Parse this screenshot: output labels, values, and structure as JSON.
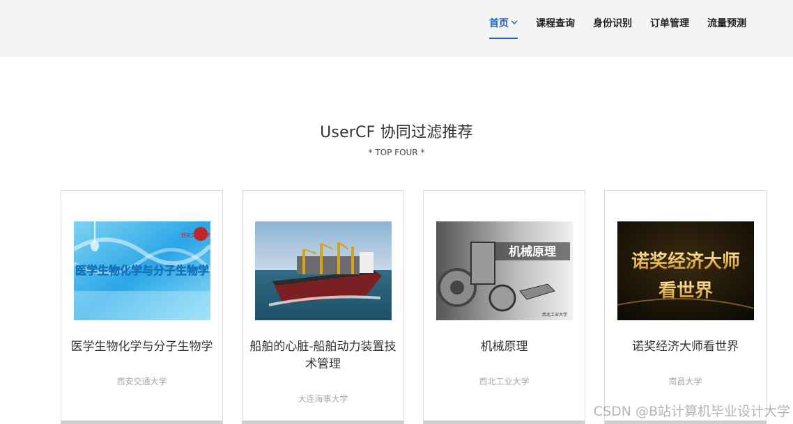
{
  "nav": {
    "items": [
      {
        "label": "首页",
        "active": true
      },
      {
        "label": "课程查询",
        "active": false
      },
      {
        "label": "身份识别",
        "active": false
      },
      {
        "label": "订单管理",
        "active": false
      },
      {
        "label": "流量预测",
        "active": false
      }
    ]
  },
  "section": {
    "title": "UserCF 协同过滤推荐",
    "subtitle": "* TOP FOUR *"
  },
  "cards": [
    {
      "title": "医学生物化学与分子生物学",
      "school": "西安交通大学",
      "image_text": "医学生物化学与分子生物学",
      "logo_text": "西安交通大学"
    },
    {
      "title": "船舶的心脏-船舶动力装置技术管理",
      "school": "大连海事大学"
    },
    {
      "title": "机械原理",
      "school": "西北工业大学",
      "image_text": "机械原理",
      "image_footer": "西北工业大学"
    },
    {
      "title": "诺奖经济大师看世界",
      "school": "南昌大学",
      "image_text_1": "诺奖经济大师",
      "image_text_2": "看世界"
    }
  ],
  "watermark": "CSDN @B站计算机毕业设计大学",
  "colors": {
    "accent": "#1e64c8",
    "topbar": "#f4f4f4"
  }
}
